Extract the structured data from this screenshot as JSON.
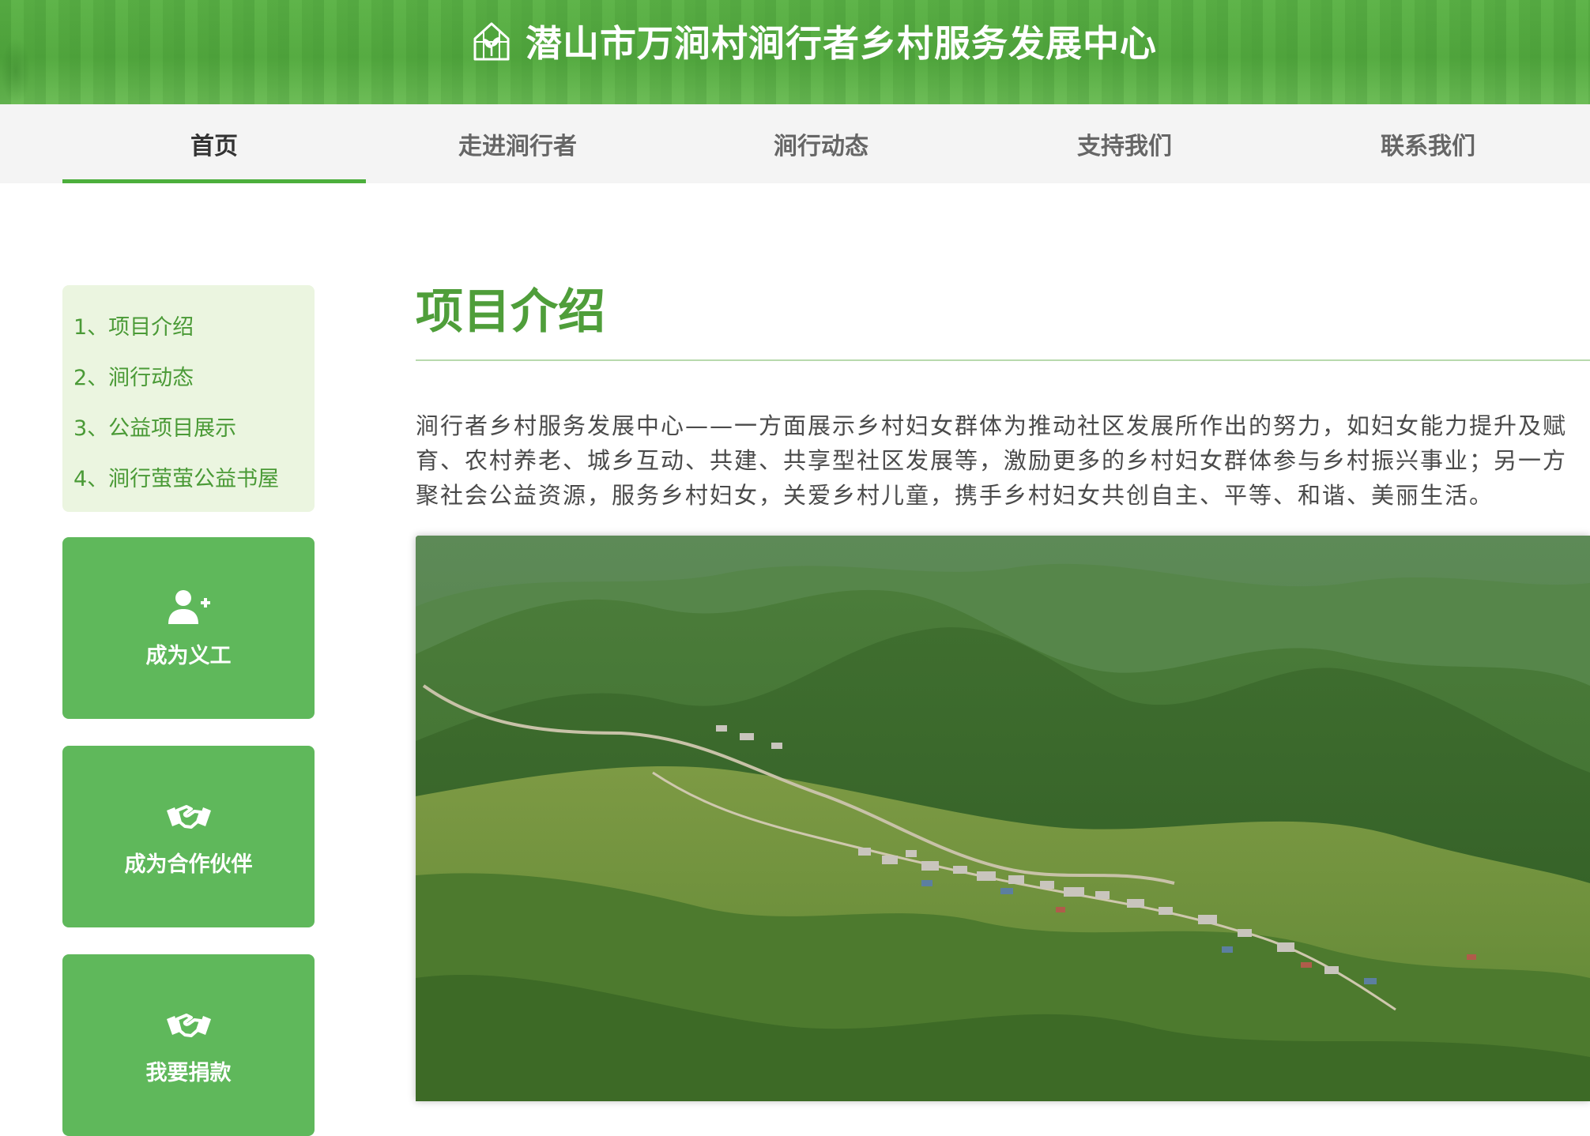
{
  "header": {
    "logo_icon": "greenhouse-leaf-icon",
    "title": "潜山市万涧村涧行者乡村服务发展中心"
  },
  "nav": {
    "tabs": [
      {
        "label": "首页",
        "active": true
      },
      {
        "label": "走进涧行者",
        "active": false
      },
      {
        "label": "涧行动态",
        "active": false
      },
      {
        "label": "支持我们",
        "active": false
      },
      {
        "label": "联系我们",
        "active": false
      }
    ]
  },
  "sidebar": {
    "menu": [
      {
        "label": "1、项目介绍"
      },
      {
        "label": "2、涧行动态"
      },
      {
        "label": "3、公益项目展示"
      },
      {
        "label": "4、涧行萤萤公益书屋"
      }
    ],
    "actions": [
      {
        "label": "成为义工",
        "icon": "user-plus-icon"
      },
      {
        "label": "成为合作伙伴",
        "icon": "handshake-icon"
      },
      {
        "label": "我要捐款",
        "icon": "handshake-icon"
      }
    ]
  },
  "main": {
    "heading": "项目介绍",
    "intro_lines": [
      "涧行者乡村服务发展中心——一方面展示乡村妇女群体为推动社区发展所作出的努力，如妇女能力提升及赋",
      "育、农村养老、城乡互动、共建、共享型社区发展等，激励更多的乡村妇女群体参与乡村振兴事业；另一方",
      "聚社会公益资源，服务乡村妇女，关爱乡村儿童，携手乡村妇女共创自主、平等、和谐、美丽生活。"
    ],
    "photo_subject": "aerial-mountain-village-photo"
  },
  "colors": {
    "brand_green": "#5cb348",
    "accent_green": "#4f9e3a",
    "card_green": "#5fb85b",
    "menu_bg": "#ebf5e0",
    "nav_bg": "#f4f4f4"
  }
}
